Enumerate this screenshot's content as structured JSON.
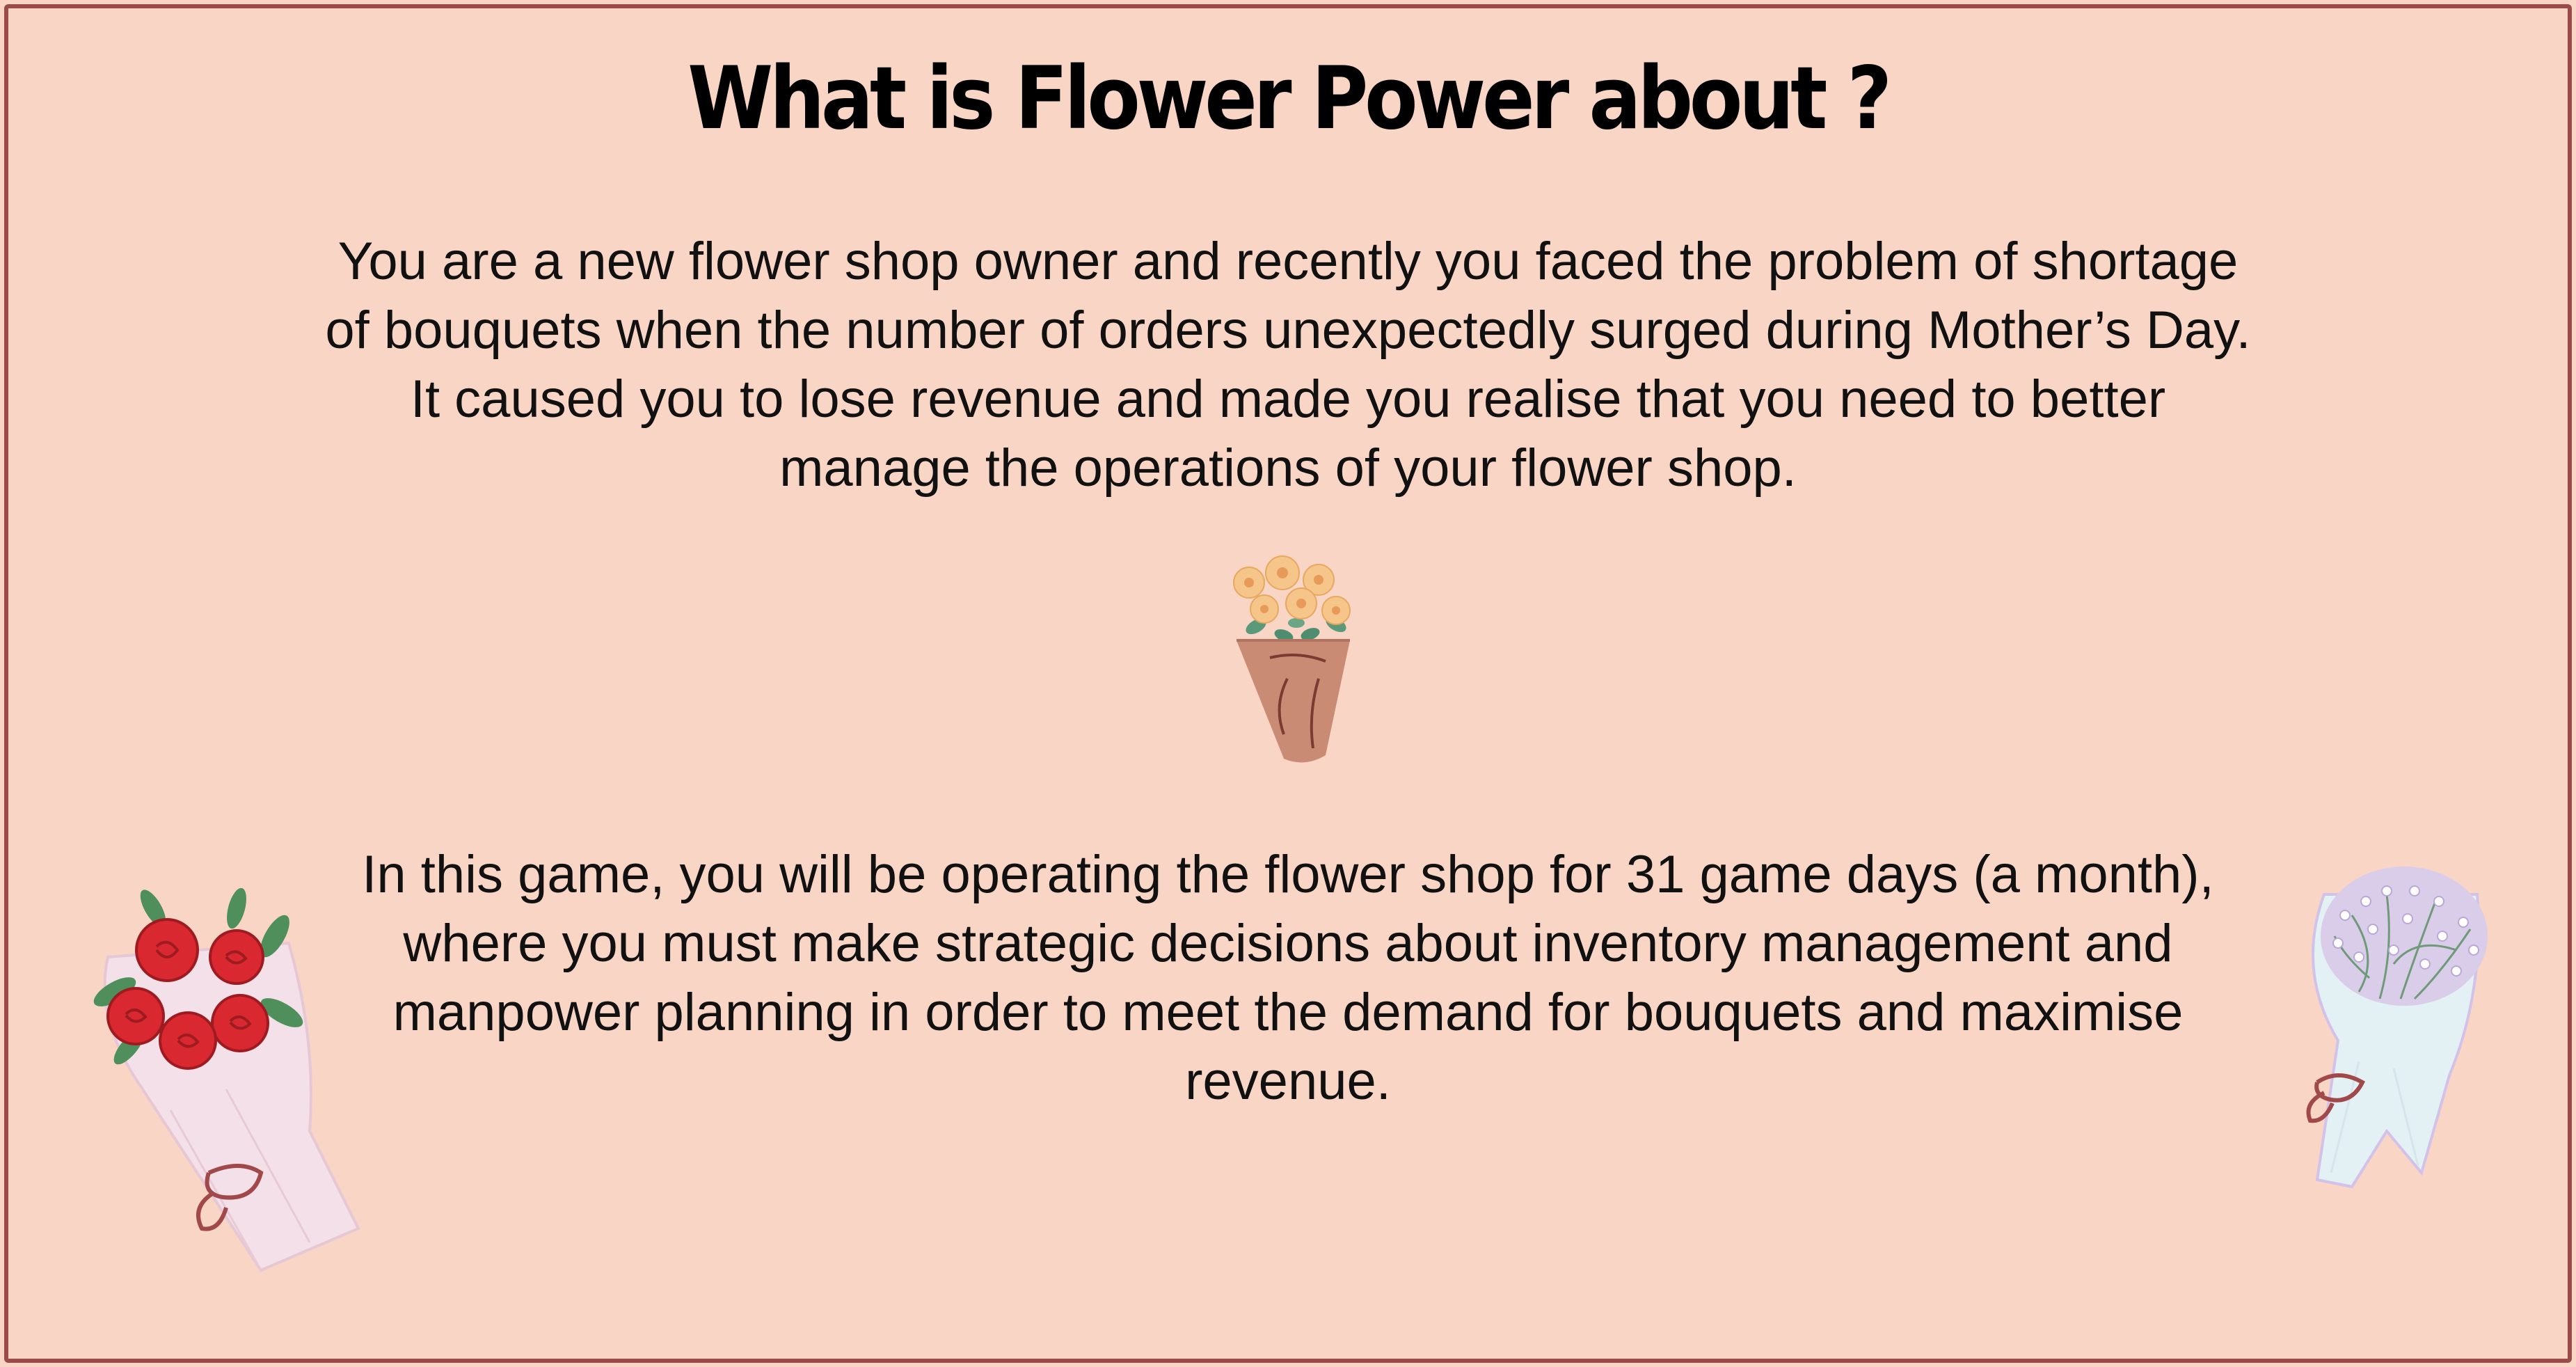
{
  "heading": "What is Flower Power about ?",
  "intro": {
    "paragraph": "You are a new flower shop owner and recently you faced the problem of shortage of bouquets when the number of orders unexpectedly surged during Mother’s Day. It caused you to lose revenue and made you realise that you need to better manage the operations of your flower shop."
  },
  "details": {
    "paragraph": "In this game, you will be operating the flower shop for 31 game days (a month), where you must make strategic decisions about inventory management and manpower planning in order to meet the demand for bouquets and maximise revenue."
  },
  "illustrations": {
    "center": "flower-pot-icon",
    "left": "rose-bouquet-icon",
    "right": "babys-breath-bouquet-icon"
  },
  "colors": {
    "background": "#f9d5c6",
    "border": "#9c4b4b",
    "text": "#111111"
  }
}
